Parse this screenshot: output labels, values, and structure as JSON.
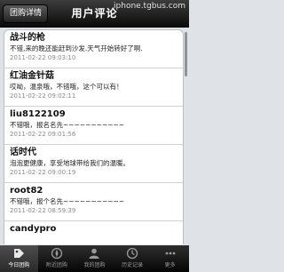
{
  "navbar": {
    "back_label": "团购详情",
    "title": "用户评论",
    "watermark": "iphone.tgbus.com"
  },
  "comments": [
    {
      "name": "战斗的枪",
      "text": "不错,来的晚还能赶到沙发.天气开始转好了啊.",
      "time": "2011-02-22 09:03:10"
    },
    {
      "name": "红油金针菇",
      "text": "哎呦，温泉哦，不错哦，这个可以有！",
      "time": "2011-02-22 09:02:11"
    },
    {
      "name": "liu8122109",
      "text": "不错哦，报名名先~~~~~~~~~~~",
      "time": "2011-02-22 09:01:56"
    },
    {
      "name": "话时代",
      "text": "泡泡更健康，享受地球带给我们的温暖。",
      "time": "2011-02-22 09:00:19"
    },
    {
      "name": "root82",
      "text": "不错哦，报个名先~~~~~~~~~~~",
      "time": "2011-02-22 08:59:39"
    },
    {
      "name": "candypro",
      "text": "",
      "time": ""
    }
  ],
  "tabbar": {
    "items": [
      {
        "label": "今日团购",
        "icon": "price-tag-icon",
        "active": true
      },
      {
        "label": "附近团购",
        "icon": "compass-icon",
        "active": false
      },
      {
        "label": "我的团购",
        "icon": "person-icon",
        "active": false
      },
      {
        "label": "历史记录",
        "icon": "clock-icon",
        "active": false
      },
      {
        "label": "更多",
        "icon": "more-icon",
        "active": false
      }
    ]
  },
  "colors": {
    "navbar_bg": "#1c1c1c",
    "list_bg": "#ffffff",
    "time_text": "#8a8a8a"
  }
}
